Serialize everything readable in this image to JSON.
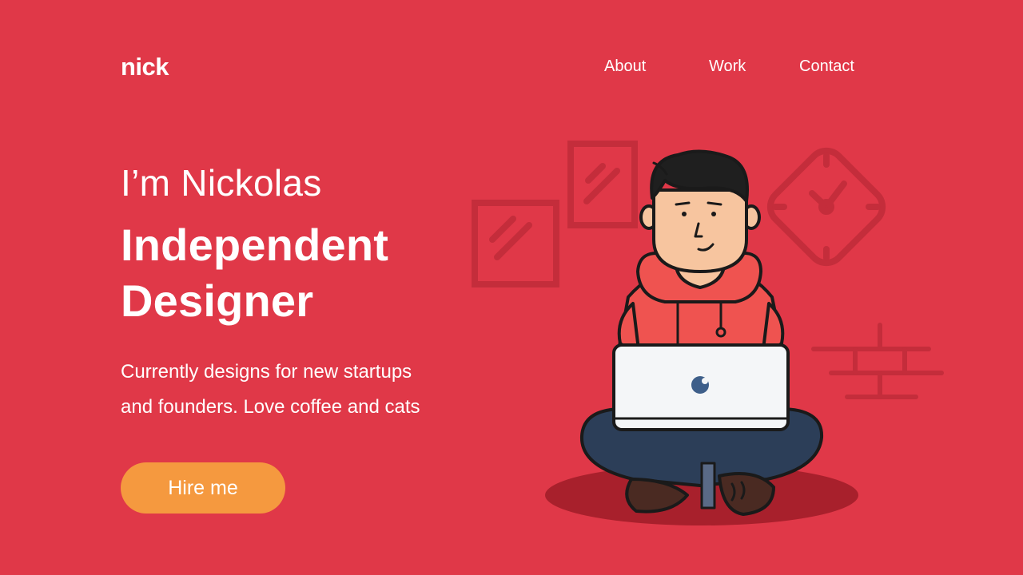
{
  "brand": {
    "logo": "nick"
  },
  "nav": {
    "items": [
      "About",
      "Work",
      "Contact"
    ]
  },
  "hero": {
    "intro": "I’m Nickolas",
    "title_line1": "Independent",
    "title_line2": "Designer",
    "desc_line1": "Currently designs for new startups",
    "desc_line2": "and founders. Love coffee and cats",
    "cta_label": "Hire me"
  },
  "colors": {
    "background": "#e03848",
    "accent": "#f5993f",
    "text": "#ffffff",
    "decor": "#c42d3b"
  },
  "icons": [
    "picture-frame-icon",
    "picture-frame-icon",
    "wall-clock-icon",
    "brick-wall-icon",
    "laptop-icon"
  ]
}
